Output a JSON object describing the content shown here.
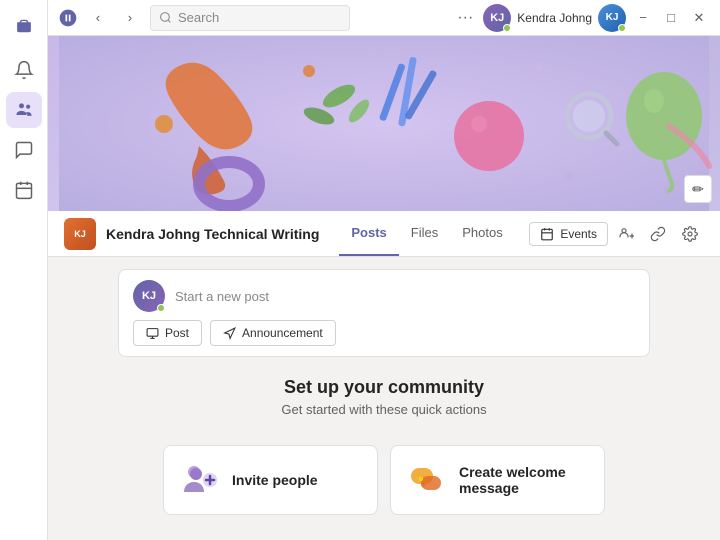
{
  "titlebar": {
    "search_placeholder": "Search",
    "user_name": "Kendra Johng",
    "user_initials": "KJ",
    "ellipsis": "···",
    "minimize": "−",
    "maximize": "□",
    "close": "✕"
  },
  "sidebar": {
    "items": [
      {
        "id": "notifications",
        "icon": "🔔",
        "label": "Notifications"
      },
      {
        "id": "teams",
        "icon": "👥",
        "label": "Teams",
        "active": true
      },
      {
        "id": "chat",
        "icon": "💬",
        "label": "Chat"
      },
      {
        "id": "calendar",
        "icon": "📅",
        "label": "Calendar"
      }
    ]
  },
  "channel": {
    "icon_text": "KJ",
    "name": "Kendra Johng Technical Writing",
    "tabs": [
      {
        "id": "posts",
        "label": "Posts",
        "active": true
      },
      {
        "id": "files",
        "label": "Files"
      },
      {
        "id": "photos",
        "label": "Photos"
      }
    ],
    "events_label": "Events",
    "edit_icon": "✏"
  },
  "new_post": {
    "placeholder": "Start a new post",
    "post_btn": "Post",
    "announcement_btn": "Announcement"
  },
  "setup": {
    "title": "Set up your community",
    "subtitle": "Get started with these quick actions"
  },
  "quick_actions": [
    {
      "id": "invite-people",
      "label": "Invite people",
      "icon": "👥"
    },
    {
      "id": "create-welcome",
      "label": "Create welcome message",
      "icon": "💬"
    }
  ]
}
